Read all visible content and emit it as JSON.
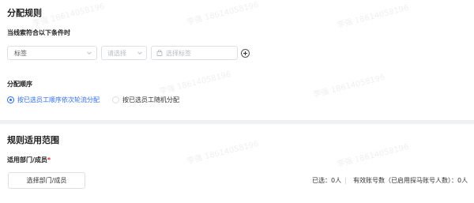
{
  "allocation_rules": {
    "section_title": "分配规则",
    "condition_label": "当线索符合以下条件时",
    "field_select": {
      "value": "标签"
    },
    "operator_select": {
      "placeholder": "请选择"
    },
    "tag_select": {
      "placeholder": "选择标签"
    },
    "add_condition_icon": "plus-circle-icon",
    "order_label": "分配顺序",
    "order_options": [
      {
        "label": "按已选员工顺序依次轮流分配",
        "selected": true
      },
      {
        "label": "按已选员工随机分配",
        "selected": false
      }
    ]
  },
  "scope": {
    "section_title": "规则适用范围",
    "dept_label": "适用部门/成员",
    "required_mark": "*",
    "select_button_label": "选择部门/成员",
    "selected_count": "已选：0人",
    "separator": "|",
    "valid_accounts": "有效账号数（已启用探马账号人数）：0人"
  },
  "watermark": {
    "text": "李强 18614058196"
  },
  "colors": {
    "accent": "#2d6cff",
    "border": "#dcdfe6",
    "placeholder": "#b8bcc4",
    "required": "#f5222d",
    "divider": "#eef0f4"
  }
}
